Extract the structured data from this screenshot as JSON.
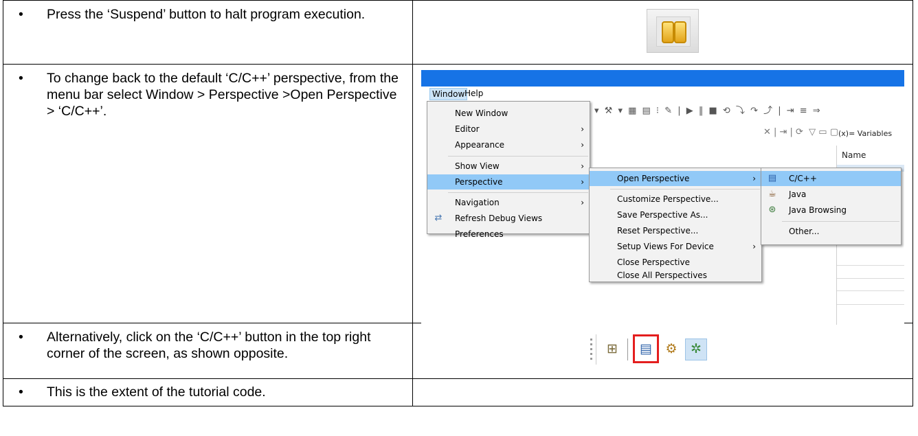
{
  "rows": [
    {
      "text": "Press the ‘Suspend’ button to halt program execution."
    },
    {
      "text": "To change back to the default ‘C/C++’ perspective, from the menu bar select Window > Perspective >Open Perspective > ‘C/C++’."
    },
    {
      "text": "Alternatively, click on the ‘C/C++’ button in the top right corner of the screen, as shown opposite."
    },
    {
      "text": "This is the extent of the tutorial code."
    }
  ],
  "suspend_icon": "pause-icon",
  "screenshot": {
    "menubar": {
      "window": "Window",
      "help": "Help"
    },
    "views": {
      "variables_tab": "(x)= Variables",
      "name_column": "Name"
    },
    "window_menu": [
      {
        "label": "New Window",
        "submenu": false
      },
      {
        "label": "Editor",
        "submenu": true
      },
      {
        "label": "Appearance",
        "submenu": true
      },
      {
        "label": "Show View",
        "submenu": true
      },
      {
        "label": "Perspective",
        "submenu": true,
        "highlighted": true
      },
      {
        "label": "Navigation",
        "submenu": true
      },
      {
        "label": "Refresh Debug Views",
        "submenu": false,
        "icon": "refresh-debug-icon"
      },
      {
        "label": "Preferences",
        "submenu": false
      }
    ],
    "perspective_menu": [
      {
        "label": "Open Perspective",
        "submenu": true,
        "highlighted": true
      },
      {
        "label": "Customize Perspective...",
        "submenu": false
      },
      {
        "label": "Save Perspective As...",
        "submenu": false
      },
      {
        "label": "Reset Perspective...",
        "submenu": false
      },
      {
        "label": "Setup Views For Device",
        "submenu": true
      },
      {
        "label": "Close Perspective",
        "submenu": false
      },
      {
        "label": "Close All Perspectives",
        "submenu": false
      }
    ],
    "open_perspective_menu": [
      {
        "label": "C/C++",
        "highlighted": true,
        "icon": "cpp-perspective-icon"
      },
      {
        "label": "Java",
        "icon": "java-perspective-icon"
      },
      {
        "label": "Java Browsing",
        "icon": "java-browsing-icon"
      },
      {
        "label": "Other..."
      }
    ]
  },
  "perspective_bar": {
    "buttons": [
      "open-perspective-icon",
      "cpp-perspective-icon",
      "java-perspective-icon",
      "debug-perspective-icon"
    ],
    "selected": "cpp-perspective-icon",
    "highlight_color": "#e41e1e"
  },
  "colors": {
    "menu_highlight": "#91c9f7",
    "titlebar": "#1673e6"
  }
}
